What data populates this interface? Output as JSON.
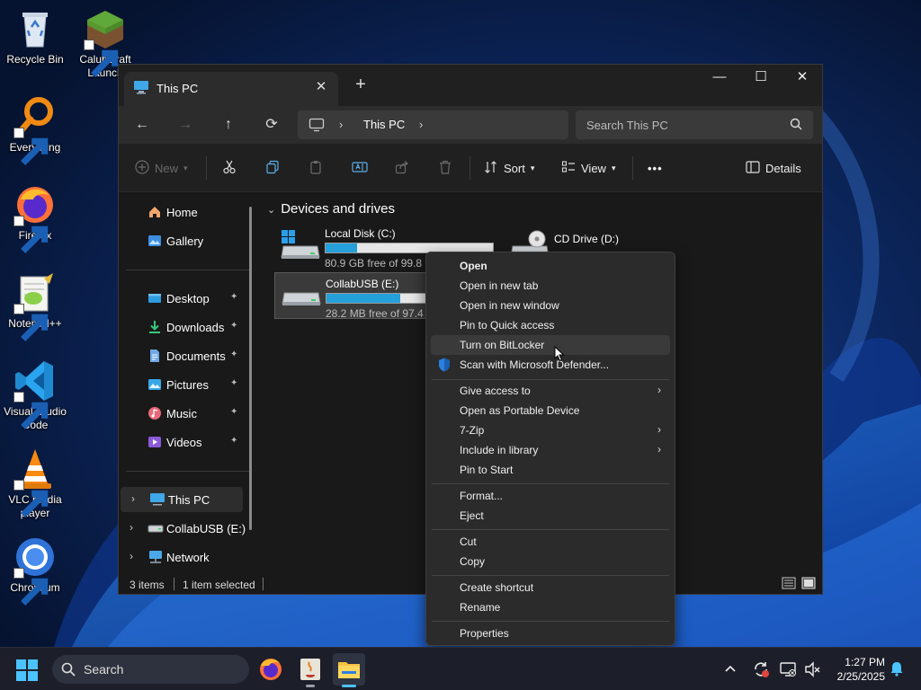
{
  "colors": {
    "accent": "#26a0da",
    "window_bg": "#191919",
    "menu_bg": "#2b2b2b",
    "taskbar_bg": "#1c1f29"
  },
  "desktop": {
    "icons": [
      {
        "label": "Recycle Bin",
        "icon": "recycle-bin-icon"
      },
      {
        "label": "CalubCraft Launch",
        "icon": "calubcraft-icon"
      },
      {
        "label": "Everything",
        "icon": "everything-icon"
      },
      {
        "label": "Firefox",
        "icon": "firefox-icon"
      },
      {
        "label": "Notepad++",
        "icon": "notepadpp-icon"
      },
      {
        "label": "Visual Studio Code",
        "icon": "vscode-icon"
      },
      {
        "label": "VLC media player",
        "icon": "vlc-icon"
      },
      {
        "label": "Chromium",
        "icon": "chromium-icon"
      }
    ]
  },
  "window": {
    "tab_title": "This PC",
    "tab_close": "✕",
    "new_tab": "+",
    "minimize": "—",
    "maximize": "☐",
    "close": "✕"
  },
  "address": {
    "back": "←",
    "forward": "→",
    "up": "↑",
    "refresh": "⟳",
    "crumb": "This PC",
    "chevron": "›",
    "search_placeholder": "Search This PC"
  },
  "toolbar": {
    "new_label": "New",
    "sort_label": "Sort",
    "view_label": "View",
    "more_label": "•••",
    "details_label": "Details"
  },
  "nav": {
    "items": [
      {
        "label": "Home",
        "icon": "home-icon"
      },
      {
        "label": "Gallery",
        "icon": "gallery-icon"
      },
      {
        "label": "Desktop",
        "icon": "desktop-folder-icon",
        "pinned": true
      },
      {
        "label": "Downloads",
        "icon": "downloads-icon",
        "pinned": true
      },
      {
        "label": "Documents",
        "icon": "documents-icon",
        "pinned": true
      },
      {
        "label": "Pictures",
        "icon": "pictures-icon",
        "pinned": true
      },
      {
        "label": "Music",
        "icon": "music-icon",
        "pinned": true
      },
      {
        "label": "Videos",
        "icon": "videos-icon",
        "pinned": true
      },
      {
        "label": "This PC",
        "icon": "this-pc-icon",
        "selected": true
      },
      {
        "label": "CollabUSB (E:)",
        "icon": "usb-drive-icon"
      },
      {
        "label": "Network",
        "icon": "network-icon"
      }
    ],
    "pin_glyph": "📌",
    "expand_glyph": "›"
  },
  "content": {
    "group_header": "Devices and drives",
    "group_chevron": "⌄",
    "drives": [
      {
        "name": "Local Disk (C:)",
        "free": "80.9 GB free of 99.8 GB",
        "used_fraction": 0.19
      },
      {
        "name": "CD Drive (D:)"
      },
      {
        "name": "CollabUSB (E:)",
        "free": "28.2 MB free of 97.4 MB",
        "used_fraction": 0.71,
        "selected": true
      }
    ]
  },
  "status": {
    "items": "3 items",
    "selected": "1 item selected"
  },
  "context_menu": {
    "items": [
      {
        "label": "Open",
        "bold": true
      },
      {
        "label": "Open in new tab"
      },
      {
        "label": "Open in new window"
      },
      {
        "label": "Pin to Quick access"
      },
      {
        "label": "Turn on BitLocker",
        "hover": true
      },
      {
        "label": "Scan with Microsoft Defender...",
        "icon": "defender-icon"
      },
      {
        "label": "Give access to",
        "submenu": true
      },
      {
        "label": "Open as Portable Device"
      },
      {
        "label": "7-Zip",
        "submenu": true
      },
      {
        "label": "Include in library",
        "submenu": true
      },
      {
        "label": "Pin to Start"
      },
      {
        "label": "Format..."
      },
      {
        "label": "Eject"
      },
      {
        "label": "Cut"
      },
      {
        "label": "Copy"
      },
      {
        "label": "Create shortcut"
      },
      {
        "label": "Rename"
      },
      {
        "label": "Properties"
      }
    ],
    "submenu_arrow": "›"
  },
  "taskbar": {
    "search_label": "Search",
    "time": "1:27 PM",
    "date": "2/25/2025",
    "apps": [
      "firefox-icon",
      "java-icon",
      "file-explorer-icon"
    ]
  }
}
